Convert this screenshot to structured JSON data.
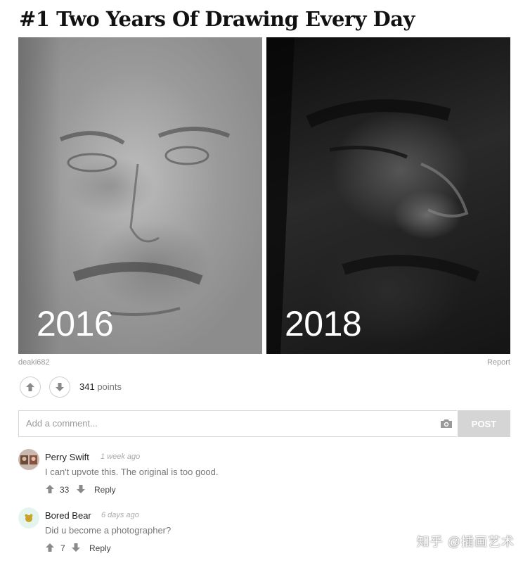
{
  "post": {
    "title": "#1 Two Years Of Drawing Every Day",
    "images": [
      {
        "year": "2016"
      },
      {
        "year": "2018"
      }
    ],
    "author": "deaki682",
    "report_label": "Report",
    "points_value": "341",
    "points_label": "points"
  },
  "comment_form": {
    "placeholder": "Add a comment...",
    "post_label": "POST"
  },
  "comments": [
    {
      "name": "Perry Swift",
      "time": "1 week ago",
      "text": "I can't upvote this. The original is too good.",
      "votes": "33",
      "reply_label": "Reply"
    },
    {
      "name": "Bored Bear",
      "time": "6 days ago",
      "text": "Did u become a photographer?",
      "votes": "7",
      "reply_label": "Reply"
    }
  ],
  "watermark": "知乎 @插画艺术",
  "colors": {
    "post_button": "#d5d5d5",
    "vote_icon": "#888888"
  }
}
